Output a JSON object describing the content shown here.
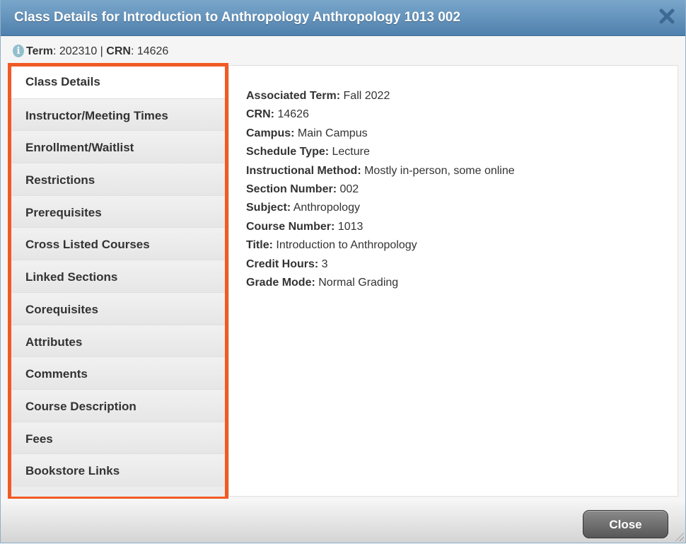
{
  "dialog": {
    "title": "Class Details for Introduction to Anthropology Anthropology 1013 002",
    "close_icon": "close-x-icon"
  },
  "info": {
    "icon": "info-icon",
    "term_label": "Term",
    "term_value": ": 202310 | ",
    "crn_label": "CRN",
    "crn_value": ": 14626"
  },
  "sidebar": {
    "items": [
      {
        "label": "Class Details",
        "active": true
      },
      {
        "label": "Instructor/Meeting Times"
      },
      {
        "label": "Enrollment/Waitlist"
      },
      {
        "label": "Restrictions"
      },
      {
        "label": "Prerequisites"
      },
      {
        "label": "Cross Listed Courses"
      },
      {
        "label": "Linked Sections"
      },
      {
        "label": "Corequisites"
      },
      {
        "label": "Attributes"
      },
      {
        "label": "Comments"
      },
      {
        "label": "Course Description"
      },
      {
        "label": "Fees"
      },
      {
        "label": "Bookstore Links"
      }
    ],
    "highlight_color": "#f15a24"
  },
  "details": [
    {
      "label": "Associated Term:",
      "value": " Fall 2022"
    },
    {
      "label": "CRN:",
      "value": " 14626"
    },
    {
      "label": "Campus:",
      "value": " Main Campus"
    },
    {
      "label": "Schedule Type:",
      "value": " Lecture"
    },
    {
      "label": "Instructional Method:",
      "value": " Mostly in-person, some online"
    },
    {
      "label": "Section Number:",
      "value": " 002"
    },
    {
      "label": "Subject:",
      "value": " Anthropology"
    },
    {
      "label": "Course Number:",
      "value": " 1013"
    },
    {
      "label": "Title:",
      "value": " Introduction to Anthropology"
    },
    {
      "label": "Credit Hours:",
      "value": " 3"
    },
    {
      "label": "Grade Mode:",
      "value": " Normal Grading"
    }
  ],
  "footer": {
    "close_label": "Close"
  }
}
